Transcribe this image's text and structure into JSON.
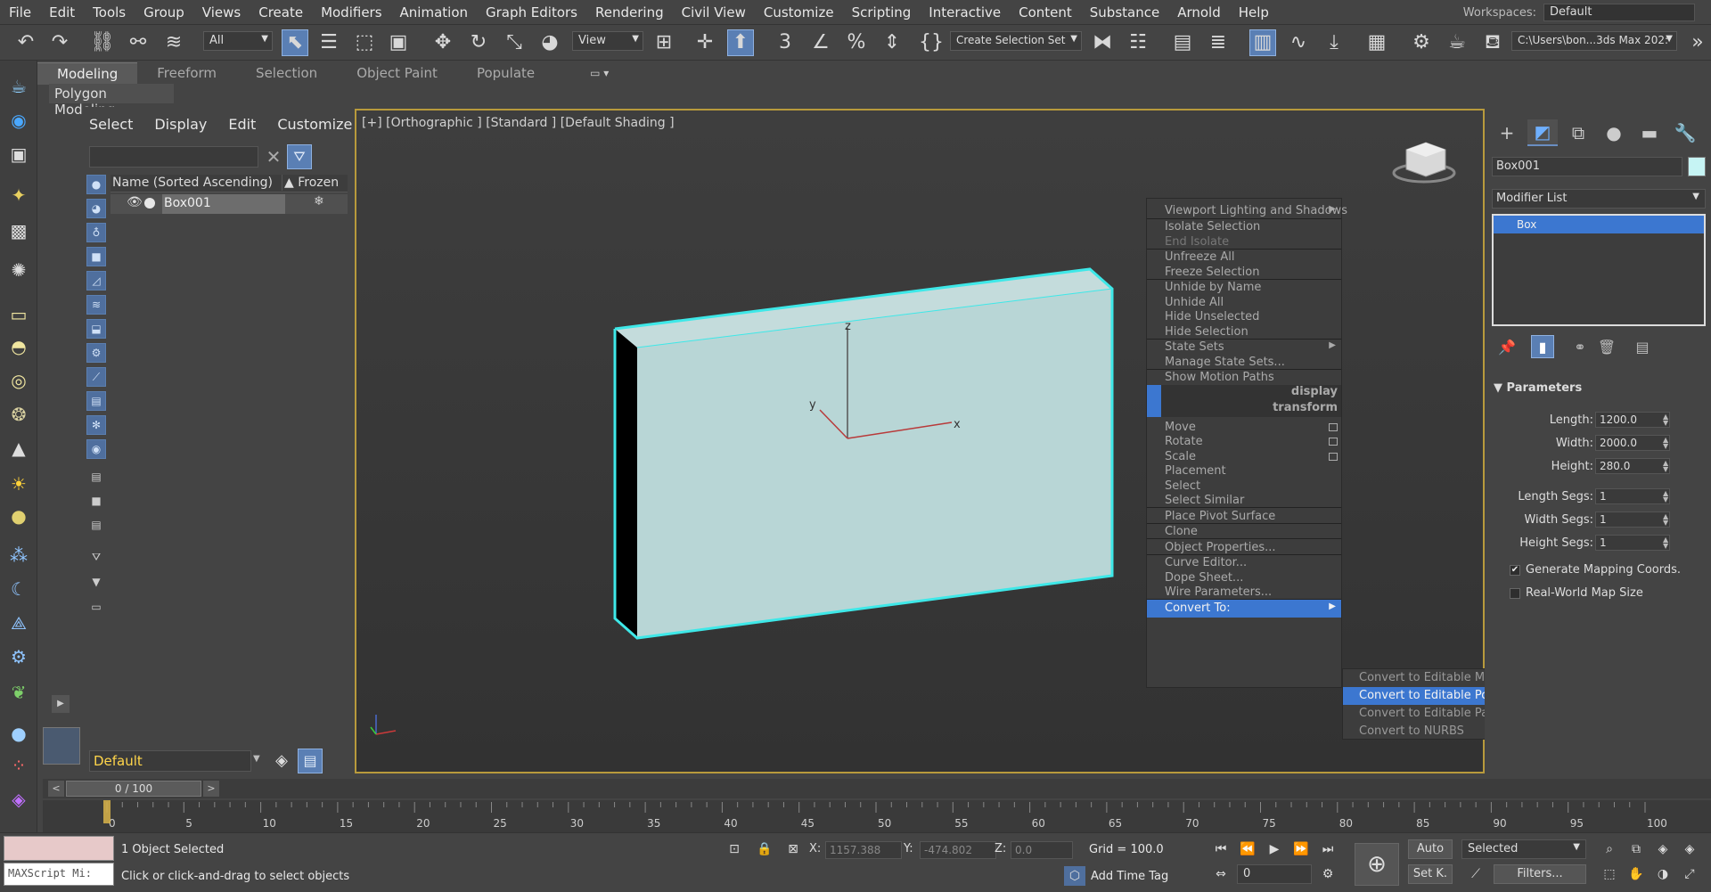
{
  "menubar": {
    "items": [
      "File",
      "Edit",
      "Tools",
      "Group",
      "Views",
      "Create",
      "Modifiers",
      "Animation",
      "Graph Editors",
      "Rendering",
      "Civil View",
      "Customize",
      "Scripting",
      "Interactive",
      "Content",
      "Substance",
      "Arnold",
      "Help"
    ],
    "workspaces_label": "Workspaces:",
    "workspaces_value": "Default"
  },
  "toolbar": {
    "filter_value": "All",
    "refcoord_value": "View",
    "selection_set_value": "Create Selection Set",
    "project_path": "C:\\Users\\bon...3ds Max 202:"
  },
  "ribbon": {
    "tabs": [
      "Modeling",
      "Freeform",
      "Selection",
      "Object Paint",
      "Populate"
    ],
    "active_tab": "Modeling",
    "panel_label": "Polygon Modeling"
  },
  "explorer": {
    "menu": [
      "Select",
      "Display",
      "Edit",
      "Customize"
    ],
    "col_name": "Name (Sorted Ascending)",
    "col_frozen": "▲ Frozen",
    "row_name": "Box001",
    "layer_value": "Default"
  },
  "viewport": {
    "label": "[+] [Orthographic ] [Standard ] [Default Shading ]",
    "axis_z": "z",
    "axis_y": "y",
    "axis_x": "x",
    "box_color": "#b8d6d6",
    "wire_color": "#3ee8e8"
  },
  "quad_menu": {
    "items": [
      {
        "label": "Viewport Lighting and Shadows",
        "sub": true
      },
      {
        "label": "Isolate Selection"
      },
      {
        "label": "End Isolate",
        "dim": true
      },
      {
        "label": "Unfreeze All"
      },
      {
        "label": "Freeze Selection"
      },
      {
        "label": "Unhide by Name"
      },
      {
        "label": "Unhide All"
      },
      {
        "label": "Hide Unselected"
      },
      {
        "label": "Hide Selection"
      },
      {
        "label": "State Sets",
        "sub": true
      },
      {
        "label": "Manage State Sets..."
      },
      {
        "label": "Show Motion Paths"
      }
    ],
    "header_display": "display",
    "header_transform": "transform",
    "transform_items": [
      {
        "label": "Move",
        "box": true
      },
      {
        "label": "Rotate",
        "box": true
      },
      {
        "label": "Scale",
        "box": true
      },
      {
        "label": "Placement"
      },
      {
        "label": "Select"
      },
      {
        "label": "Select Similar"
      },
      {
        "label": "Place Pivot Surface"
      },
      {
        "label": "Clone"
      },
      {
        "label": "Object Properties..."
      },
      {
        "label": "Curve Editor..."
      },
      {
        "label": "Dope Sheet..."
      },
      {
        "label": "Wire Parameters..."
      },
      {
        "label": "Convert To:",
        "sub": true,
        "selected": true
      }
    ],
    "submenu": [
      "Convert to Editable Mesh",
      "Convert to Editable Poly",
      "Convert to Editable Patch",
      "Convert to NURBS"
    ],
    "submenu_selected": 1
  },
  "command_panel": {
    "object_name": "Box001",
    "object_color": "#c6f4f4",
    "modifier_list": "Modifier List",
    "stack_item": "Box",
    "params_title": "Parameters",
    "params": [
      {
        "label": "Length:",
        "value": "1200.0"
      },
      {
        "label": "Width:",
        "value": "2000.0"
      },
      {
        "label": "Height:",
        "value": "280.0"
      },
      {
        "label": "Length Segs:",
        "value": "1"
      },
      {
        "label": "Width Segs:",
        "value": "1"
      },
      {
        "label": "Height Segs:",
        "value": "1"
      }
    ],
    "gen_mapping": "Generate Mapping Coords.",
    "real_world": "Real-World Map Size"
  },
  "timeline": {
    "slider_text": "0 / 100",
    "ticks": [
      "0",
      "5",
      "10",
      "15",
      "20",
      "25",
      "30",
      "35",
      "40",
      "45",
      "50",
      "55",
      "60",
      "65",
      "70",
      "75",
      "80",
      "85",
      "90",
      "95",
      "100"
    ]
  },
  "status": {
    "maxscript": "MAXScript Mi:",
    "selected": "1 Object Selected",
    "prompt": "Click or click-and-drag to select objects",
    "x_label": "X:",
    "x_value": "1157.388",
    "y_label": "Y:",
    "y_value": "-474.802",
    "z_label": "Z:",
    "z_value": "0.0",
    "grid": "Grid = 100.0",
    "add_time_tag": "Add Time Tag",
    "auto": "Auto",
    "set_key": "Set K.",
    "selected_dd": "Selected",
    "frame_value": "0",
    "filters": "Filters..."
  }
}
